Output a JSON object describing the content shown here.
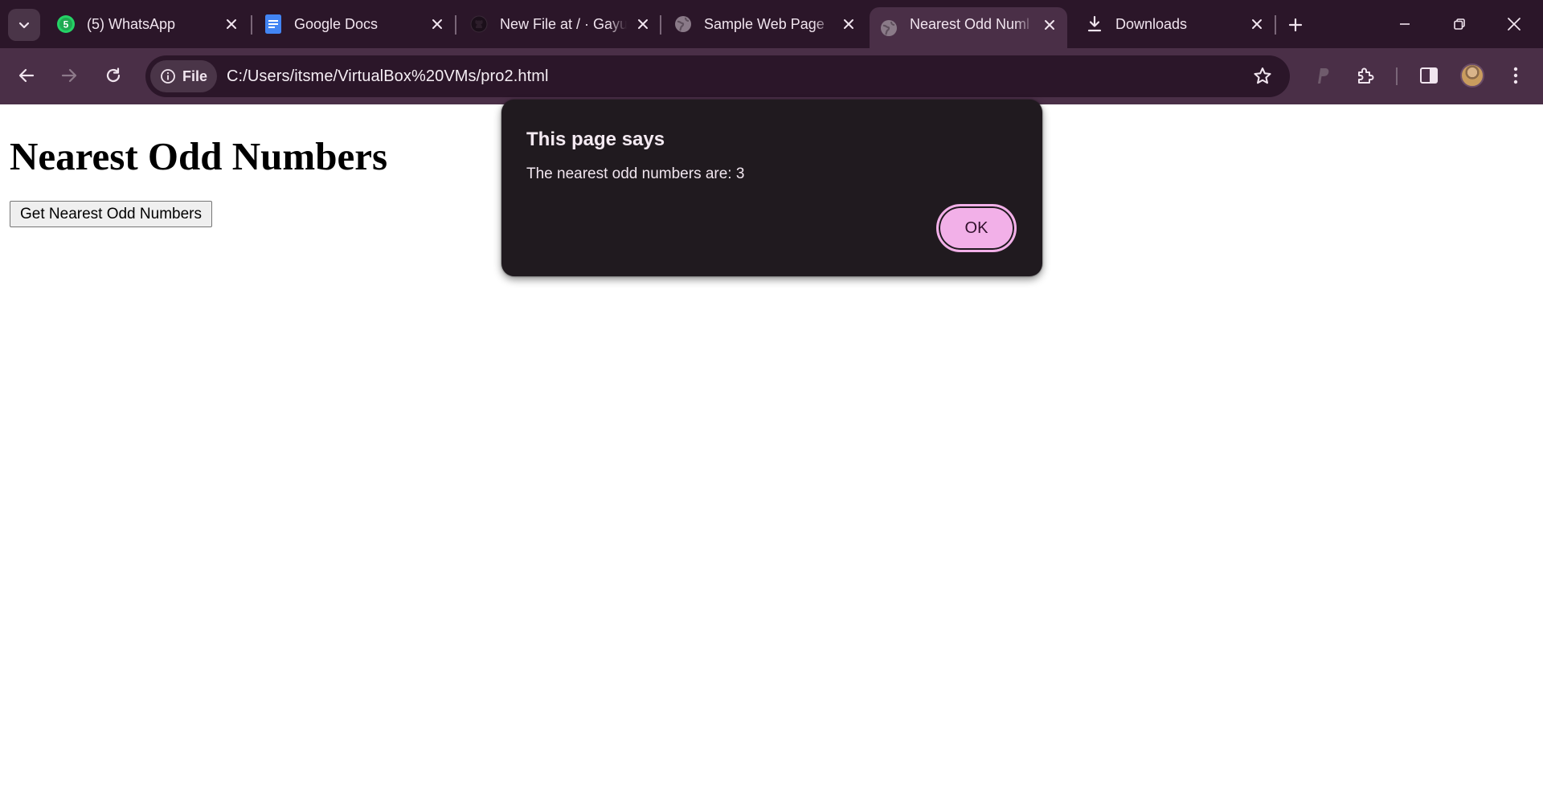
{
  "tabs": [
    {
      "title": "(5) WhatsApp",
      "icon": "whatsapp-icon",
      "badge": "5",
      "active": false
    },
    {
      "title": "Google Docs",
      "icon": "google-docs-icon",
      "active": false
    },
    {
      "title": "New File at / · Gayu",
      "icon": "github-icon",
      "active": false
    },
    {
      "title": "Sample Web Page",
      "icon": "globe-icon",
      "active": false
    },
    {
      "title": "Nearest Odd Numl",
      "icon": "globe-icon",
      "active": true
    },
    {
      "title": "Downloads",
      "icon": "download-icon",
      "active": false
    }
  ],
  "toolbar": {
    "security_chip_label": "File",
    "url": "C:/Users/itsme/VirtualBox%20VMs/pro2.html"
  },
  "page": {
    "heading": "Nearest Odd Numbers",
    "button_label": "Get Nearest Odd Numbers"
  },
  "dialog": {
    "title": "This page says",
    "message": "The nearest odd numbers are: 3",
    "ok_label": "OK"
  },
  "colors": {
    "tabstrip_bg": "#2b1629",
    "toolbar_bg": "#4a2f47",
    "dialog_bg": "#201a1f",
    "ok_button": "#f2b0e8",
    "whatsapp_green": "#25d366",
    "docs_blue": "#4285f4"
  }
}
